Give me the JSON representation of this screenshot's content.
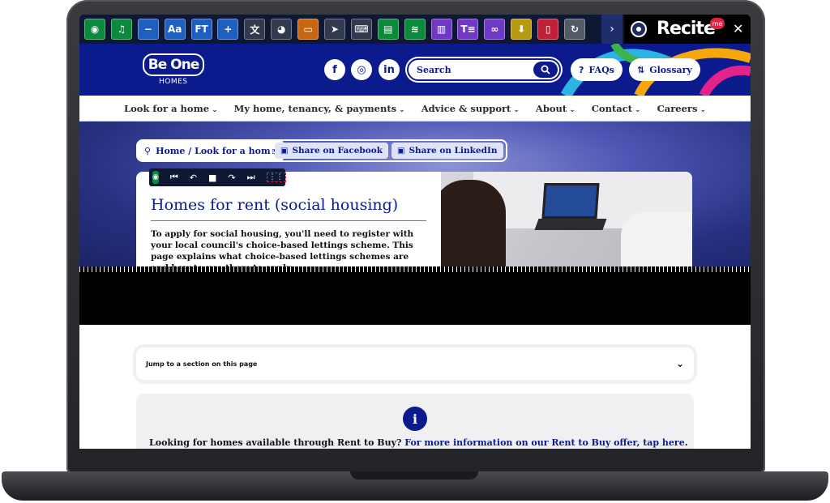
{
  "recite_toolbar": {
    "buttons": [
      {
        "icon": "speech-icon",
        "glyph": "◉",
        "color": "#0c8a3c"
      },
      {
        "icon": "music-note-icon",
        "glyph": "♫",
        "color": "#0c8a3c"
      },
      {
        "icon": "zoom-out-icon",
        "glyph": "−",
        "color": "#1f5fbf"
      },
      {
        "icon": "font-size-icon",
        "glyph": "Aa",
        "color": "#1f5fbf"
      },
      {
        "icon": "font-type-icon",
        "glyph": "FT",
        "color": "#1f5fbf"
      },
      {
        "icon": "zoom-in-icon",
        "glyph": "+",
        "color": "#1f5fbf"
      },
      {
        "icon": "translate-icon",
        "glyph": "文",
        "color": "#333a4f"
      },
      {
        "icon": "color-wheel-icon",
        "glyph": "◕",
        "color": "#333a4f"
      },
      {
        "icon": "ruler-icon",
        "glyph": "▭",
        "color": "#c8660f"
      },
      {
        "icon": "cursor-icon",
        "glyph": "➤",
        "color": "#333a4f"
      },
      {
        "icon": "keyboard-icon",
        "glyph": "⌨",
        "color": "#333a4f"
      },
      {
        "icon": "text-mode-icon",
        "glyph": "▤",
        "color": "#0c8a3c"
      },
      {
        "icon": "layers-icon",
        "glyph": "≋",
        "color": "#0c8a3c"
      },
      {
        "icon": "dictionary-icon",
        "glyph": "▥",
        "color": "#6f38c5"
      },
      {
        "icon": "text-options-icon",
        "glyph": "T≡",
        "color": "#6f38c5"
      },
      {
        "icon": "reading-glasses-icon",
        "glyph": "∞",
        "color": "#6f38c5"
      },
      {
        "icon": "download-icon",
        "glyph": "⬇",
        "color": "#b89a10"
      },
      {
        "icon": "pdf-icon",
        "glyph": "▯",
        "color": "#c21f3a"
      },
      {
        "icon": "reset-icon",
        "glyph": "↻",
        "color": "#555b66"
      }
    ],
    "next_glyph": "›",
    "brand": "Recite",
    "badge": "me",
    "close_glyph": "✕"
  },
  "header": {
    "logo_text": "Be One",
    "logo_sub": "HOMES",
    "search_placeholder": "Search",
    "faqs_label": "FAQs",
    "glossary_label": "Glossary"
  },
  "nav": {
    "items": [
      "Look for a home",
      "My home, tenancy, & payments",
      "Advice & support",
      "About",
      "Contact",
      "Careers"
    ]
  },
  "hero": {
    "breadcrumb": "Home / Look for a home",
    "share_facebook": "Share on Facebook",
    "share_linkedin": "Share on LinkedIn",
    "title": "Homes for rent (social housing)",
    "intro": "To apply for social housing, you'll need to register with your local council's choice-based lettings scheme. This page explains what choice-based lettings schemes are and how to use them to apply"
  },
  "lower": {
    "jump_label": "Jump to a section on this page",
    "info_text": "Looking for homes available through Rent to Buy? ",
    "info_link": "For more information on our Rent to Buy offer, tap here",
    "info_end": "."
  },
  "colors": {
    "brand_blue": "#0b1a8c",
    "recite_dark": "#0e1833"
  }
}
